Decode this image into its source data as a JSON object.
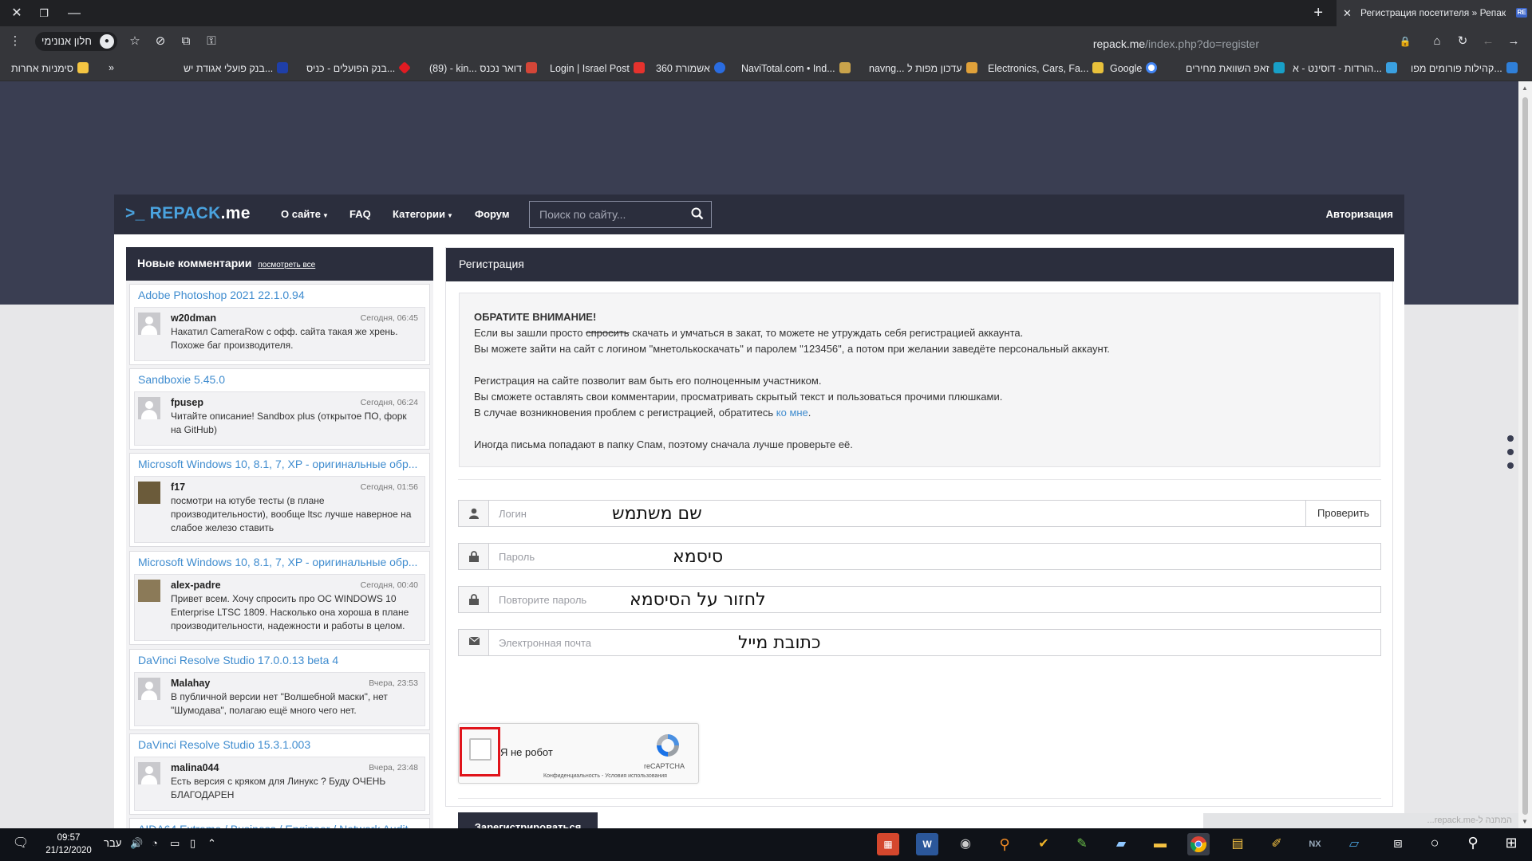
{
  "browser": {
    "tab_title": "Регистрация посетителя » Репак",
    "tab_favicon": "RE",
    "url_host": "repack.me",
    "url_path": "/index.php?do=register",
    "incognito_label": "חלון אנונימי",
    "bookmarks": [
      {
        "label": "סימניות אחרות",
        "color": "#f4c542"
      },
      {
        "label": "»",
        "color": ""
      },
      {
        "label": "בנק פועלי אגודת יש...",
        "color": "#1f3fa8"
      },
      {
        "label": "בנק הפועלים - כניס...",
        "color": "#e01b22"
      },
      {
        "label": "(89) - kin... דואר נכנס",
        "color": "#d44638"
      },
      {
        "label": "Login | Israel Post",
        "color": "#e5322d"
      },
      {
        "label": "אשמורת 360",
        "color": "#2a6ce0"
      },
      {
        "label": "NaviTotal.com • Ind...",
        "color": "#c9a34b"
      },
      {
        "label": "navng... עדכון מפות ל",
        "color": "#e0a13a"
      },
      {
        "label": "Electronics, Cars, Fa...",
        "color": "#e8c13b"
      },
      {
        "label": "Google",
        "color": "#4285f4"
      },
      {
        "label": "זאפ השוואת מחירים",
        "color": "#18a0c8"
      },
      {
        "label": "הורדות - דוסינט - א...",
        "color": "#3aa0e0"
      },
      {
        "label": "קהילות פורומים מפו...",
        "color": "#2f7fd8"
      }
    ]
  },
  "site": {
    "logo_prefix": ">_ REPACK",
    "logo_suffix": ".me",
    "nav": [
      "О сайте",
      "FAQ",
      "Категории",
      "Форум"
    ],
    "search_placeholder": "Поиск по сайту...",
    "auth_label": "Авторизация"
  },
  "sidebar": {
    "title": "Новые комментарии",
    "view_all": "посмотреть все",
    "comments": [
      {
        "title": "Adobe Photoshop 2021 22.1.0.94",
        "user": "w20dman",
        "date": "Сегодня, 06:45",
        "text": "Накатил CameraRow с офф. сайта такая же хрень. Похоже баг производителя."
      },
      {
        "title": "Sandboxie 5.45.0",
        "user": "fpusep",
        "date": "Сегодня, 06:24",
        "text": "Читайте описание! Sandbox plus (открытое ПО, форк на GitHub)"
      },
      {
        "title": "Microsoft Windows 10, 8.1, 7, XP - оригинальные обр...",
        "user": "f17",
        "date": "Сегодня, 01:56",
        "text": "посмотри на ютубе тесты (в плане производительности), вообще ltsc лучше наверное на слабое железо ставить"
      },
      {
        "title": "Microsoft Windows 10, 8.1, 7, XP - оригинальные обр...",
        "user": "alex-padre",
        "date": "Сегодня, 00:40",
        "text": "Привет всем. Хочу спросить про ОС WINDOWS 10 Enterprise LTSC 1809. Насколько она хороша в плане производительности, надежности и работы в целом."
      },
      {
        "title": "DaVinci Resolve Studio 17.0.0.13 beta 4",
        "user": "Malahay",
        "date": "Вчера, 23:53",
        "text": "В публичной версии нет \"Волшебной маски\", нет \"Шумодава\", полагаю ещё много чего нет."
      },
      {
        "title": "DaVinci Resolve Studio 15.3.1.003",
        "user": "malina044",
        "date": "Вчера, 23:48",
        "text": "Есть версия с кряком для Линукс ? Буду ОЧЕНЬ БЛАГОДАРЕН"
      },
      {
        "title": "AIDA64 Extreme / Business / Engineer / Network Audit",
        "user": "",
        "date": "",
        "text": ""
      }
    ]
  },
  "registration": {
    "title": "Регистрация",
    "notice_heading": "ОБРАТИТЕ ВНИМАНИЕ!",
    "notice_line1_a": "Если вы зашли просто ",
    "notice_line1_strike": "спросить",
    "notice_line1_b": " скачать и умчаться в закат, то можете не утруждать себя регистрацией аккаунта.",
    "notice_line2": "Вы можете зайти на сайт с логином \"мнетолькоскачать\" и паролем \"123456\", а потом при желании заведёте персональный аккаунт.",
    "notice_line3": "Регистрация на сайте позволит вам быть его полноценным участником.",
    "notice_line4": "Вы сможете оставлять свои комментарии, просматривать скрытый текст и пользоваться прочими плюшками.",
    "notice_line5_a": "В случае возникновения проблем с регистрацией, обратитесь ",
    "notice_line5_link": "ко мне",
    "notice_line5_b": ".",
    "notice_line6": "Иногда письма попадают в папку Спам, поэтому сначала лучше проверьте её.",
    "fields": {
      "login_placeholder": "Логин",
      "login_overlay": "שם משתמש",
      "check_label": "Проверить",
      "password_placeholder": "Пароль",
      "password_overlay": "סיסמא",
      "repeat_placeholder": "Повторите пароль",
      "repeat_overlay": "לחזור על הסיסמא",
      "email_placeholder": "Электронная почта",
      "email_overlay": "כתובת מייל"
    },
    "captcha_label": "Я не робот",
    "captcha_brand": "reCAPTCHA",
    "captcha_links": "Конфиденциальность - Условия использования",
    "submit_label": "Зарегистрироваться",
    "status_text": "...repack.me-המתנה ל"
  },
  "taskbar": {
    "time": "09:57",
    "date": "21/12/2020",
    "lang": "עבר",
    "apps": [
      "W",
      "R"
    ]
  },
  "colors": {
    "dark": "#2b2e3d",
    "link": "#3f8ccf",
    "highlight": "#e0141b"
  }
}
